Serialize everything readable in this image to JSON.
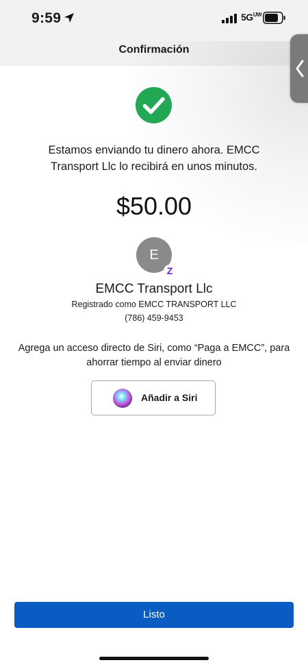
{
  "status_bar": {
    "time": "9:59",
    "network": "5G",
    "network_suffix": "UW",
    "location_icon": "location-arrow-icon",
    "signal_icon": "cellular-signal-icon",
    "battery_icon": "battery-icon"
  },
  "header": {
    "title": "Confirmación"
  },
  "side_tab": {
    "icon": "chevron-left-icon"
  },
  "confirmation": {
    "success_icon": "checkmark-circle-icon",
    "message": "Estamos enviando tu dinero ahora. EMCC Transport Llc lo recibirá en unos minutos.",
    "amount": "$50.00"
  },
  "recipient": {
    "initial": "E",
    "badge": "Z",
    "name": "EMCC Transport Llc",
    "registered_as": "Registrado como EMCC TRANSPORT LLC",
    "phone": "(786) 459-9453"
  },
  "siri": {
    "prompt": "Agrega un acceso directo de Siri, como “Paga a EMCC”, para ahorrar tiempo al enviar dinero",
    "button_label": "Añadir a Siri",
    "icon": "siri-icon"
  },
  "actions": {
    "done_label": "Listo"
  },
  "colors": {
    "accent": "#0a5cc2",
    "success": "#22a855",
    "zelle": "#6d1ed4"
  }
}
